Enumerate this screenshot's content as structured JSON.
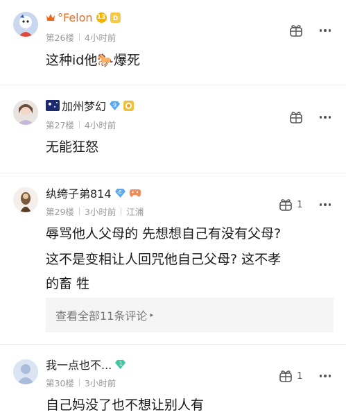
{
  "comments": [
    {
      "username": "°Felon",
      "level": "13",
      "floor": "第26楼",
      "time": "4小时前",
      "location": "",
      "content": "这种id他🐎爆死",
      "gift_count": "",
      "badge_color": "#f5b300",
      "vip_color": "#f7c948"
    },
    {
      "username": "加州梦幻",
      "level": "9",
      "floor": "第27楼",
      "time": "4小时前",
      "location": "",
      "content": "无能狂怒",
      "gift_count": "",
      "badge_color": "#5aa8f0",
      "vip_color": "#f0a020"
    },
    {
      "username": "纨绔子弟814",
      "level": "6",
      "floor": "第29楼",
      "time": "3小时前",
      "location": "江浦",
      "content_lines": [
        "辱骂他人父母的 先想想自己有没有父母?",
        "这不是变相让人回咒他自己父母? 这不孝",
        "的畜 牲"
      ],
      "gift_count": "1",
      "reply_link": "查看全部11条评论",
      "badge_color": "#5aa8f0",
      "vip_color": "#f08a5a"
    },
    {
      "username": "我一点也不...",
      "level": "1",
      "floor": "第30楼",
      "time": "3小时前",
      "location": "",
      "content": "自己妈没了也不想让别人有",
      "gift_count": "1",
      "badge_color": "#3cc8a0"
    }
  ],
  "colors": {
    "name_highlight": "#ee6a1a",
    "meta": "#9a9a9a",
    "divider": "#ececec"
  },
  "icons": [
    "crown-icon",
    "level-badge",
    "vip-icon",
    "diamond-level-icon",
    "gamepad-icon",
    "gift-icon",
    "more-icon",
    "chevron-right-icon"
  ]
}
